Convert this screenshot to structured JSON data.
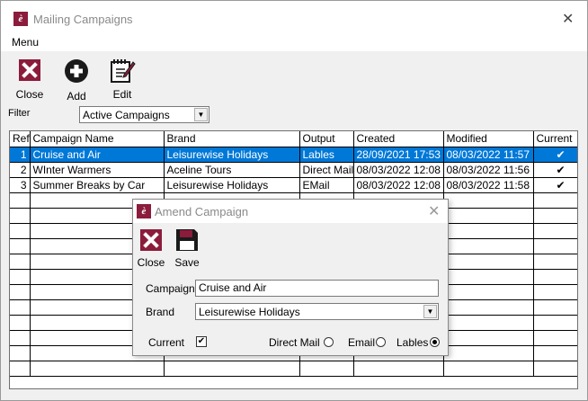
{
  "window": {
    "title": "Mailing Campaigns",
    "icon_letter": "è"
  },
  "menu": {
    "items": [
      "Menu"
    ]
  },
  "toolbar": {
    "close_label": "Close",
    "add_label": "Add",
    "edit_label": "Edit"
  },
  "filter": {
    "label": "Filter",
    "selected": "Active Campaigns"
  },
  "grid": {
    "columns": [
      "Ref",
      "Campaign Name",
      "Brand",
      "Output",
      "Created",
      "Modified",
      "Current"
    ],
    "rows": [
      {
        "ref": "1",
        "name": "Cruise and Air",
        "brand": "Leisurewise Holidays",
        "output": "Lables",
        "created": "28/09/2021 17:53",
        "modified": "08/03/2022 11:57",
        "current": "✔"
      },
      {
        "ref": "2",
        "name": "WInter Warmers",
        "brand": "Aceline Tours",
        "output": "Direct Mail",
        "created": "08/03/2022 12:08",
        "modified": "08/03/2022 11:56",
        "current": "✔"
      },
      {
        "ref": "3",
        "name": "Summer Breaks by Car",
        "brand": "Leisurewise Holidays",
        "output": "EMail",
        "created": "08/03/2022 12:08",
        "modified": "08/03/2022 11:58",
        "current": "✔"
      }
    ],
    "selected_row": 0
  },
  "dialog": {
    "title": "Amend Campaign",
    "icon_letter": "è",
    "close_label": "Close",
    "save_label": "Save",
    "campaign_label": "Campaign",
    "campaign_value": "Cruise and Air",
    "brand_label": "Brand",
    "brand_value": "Leisurewise Holidays",
    "current_label": "Current",
    "current_checked": true,
    "output_options": [
      "Direct Mail",
      "Email",
      "Lables"
    ],
    "output_selected": "Lables"
  },
  "colors": {
    "accent": "#8b1c3b",
    "selection": "#0078d7"
  }
}
